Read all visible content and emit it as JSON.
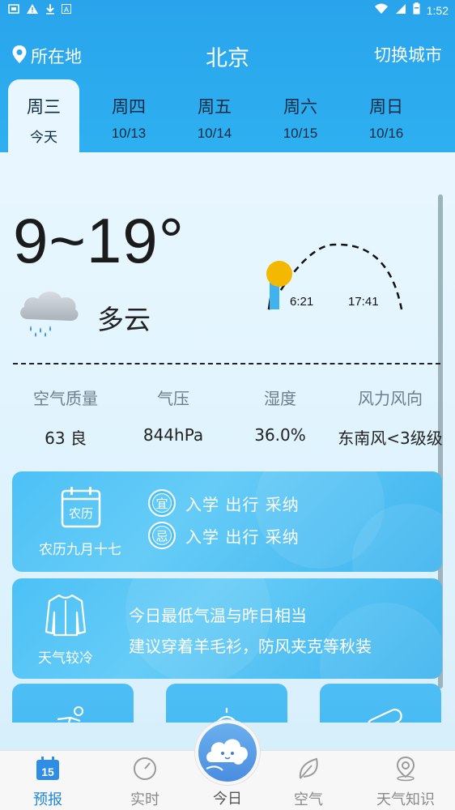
{
  "status_bar": {
    "time": "1:52",
    "icons": [
      "sim-icon",
      "warning-icon",
      "download-icon",
      "a-icon",
      "wifi-icon",
      "signal-icon",
      "battery-icon"
    ]
  },
  "header": {
    "location_label": "所在地",
    "city": "北京",
    "switch_label": "切换城市"
  },
  "days": [
    {
      "dow": "周三",
      "date": "今天"
    },
    {
      "dow": "周四",
      "date": "10/13"
    },
    {
      "dow": "周五",
      "date": "10/14"
    },
    {
      "dow": "周六",
      "date": "10/15"
    },
    {
      "dow": "周日",
      "date": "10/16"
    }
  ],
  "today": {
    "temp_range": "9~19°",
    "condition": "多云",
    "sunrise": "6:21",
    "sunset": "17:41"
  },
  "stats": [
    {
      "label": "空气质量",
      "value": "63 良"
    },
    {
      "label": "气压",
      "value": "844hPa"
    },
    {
      "label": "湿度",
      "value": "36.0%"
    },
    {
      "label": "风力风向",
      "value": "东南风<3级级"
    }
  ],
  "calendar": {
    "icon_text": "农历",
    "lunar_date": "农历九月十七",
    "yi_badge": "宜",
    "yi_items": "入学 出行 采纳",
    "ji_badge": "忌",
    "ji_items": "入学 出行 采纳"
  },
  "clothing": {
    "label": "天气较冷",
    "line1": "今日最低气温与昨日相当",
    "line2": "建议穿着羊毛衫，防风夹克等秋装"
  },
  "bottom_nav": {
    "forecast_icon_text": "15",
    "items": [
      {
        "label": "预报"
      },
      {
        "label": "实时"
      },
      {
        "label": "今日"
      },
      {
        "label": "空气"
      },
      {
        "label": "天气知识"
      }
    ]
  },
  "colors": {
    "primary": "#2eaaf0",
    "active_nav": "#1e88d8",
    "sun": "#f5b800"
  }
}
